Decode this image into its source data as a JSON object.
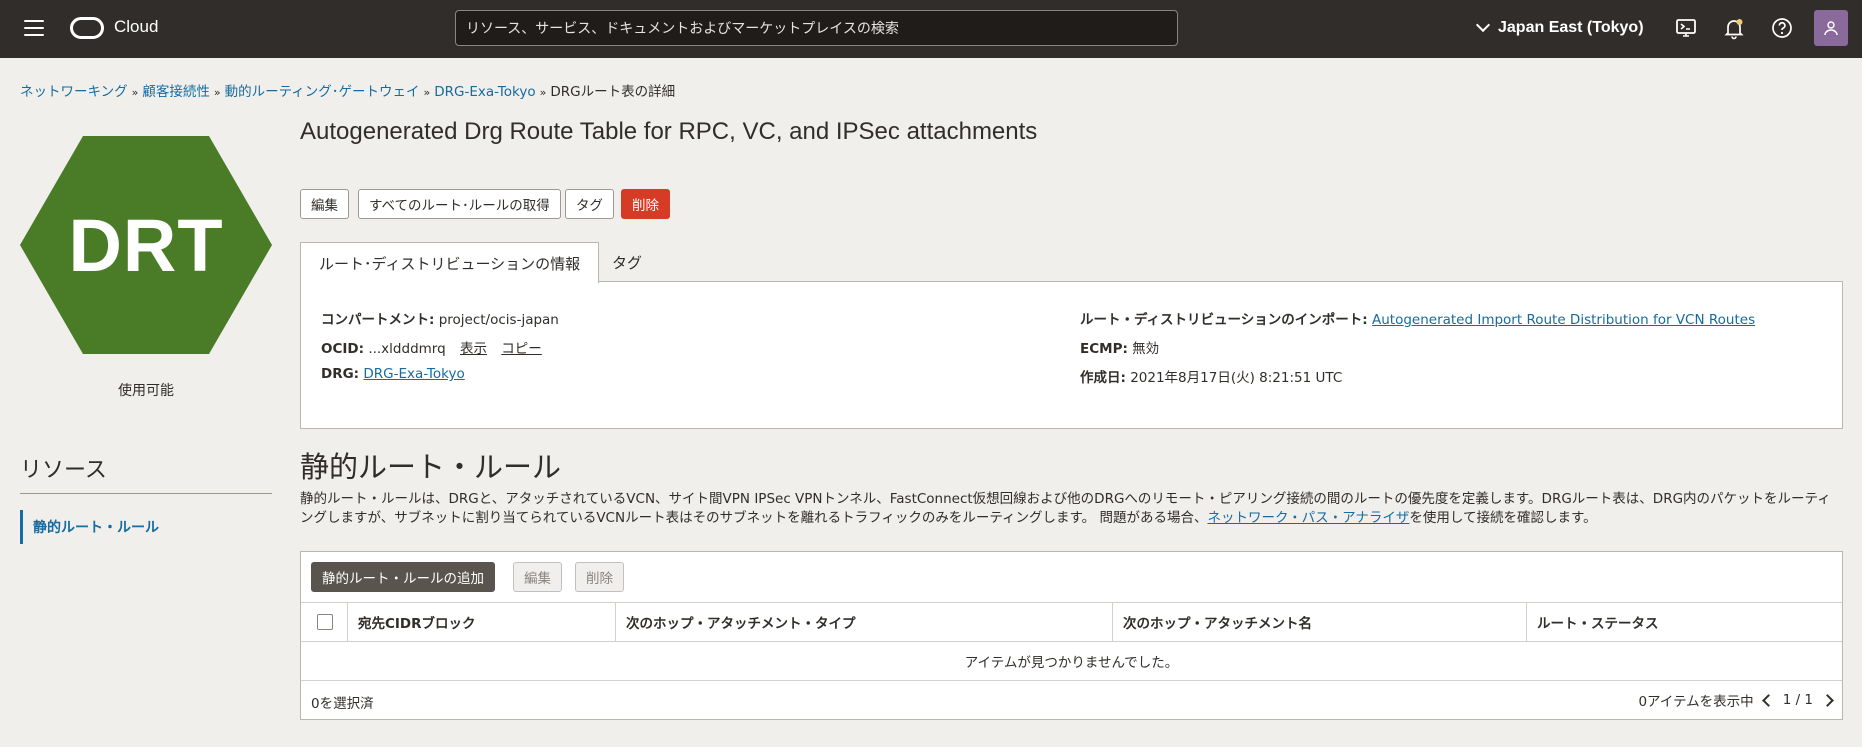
{
  "header": {
    "brand": "Cloud",
    "search_placeholder": "リソース、サービス、ドキュメントおよびマーケットプレイスの検索",
    "region": "Japan East (Tokyo)"
  },
  "breadcrumb": {
    "items": [
      "ネットワーキング",
      "顧客接続性",
      "動的ルーティング･ゲートウェイ",
      "DRG-Exa-Tokyo"
    ],
    "current": "DRGルート表の詳細",
    "separator": "»"
  },
  "resource_icon": {
    "abbr": "DRT",
    "color": "#4a7b27",
    "status": "使用可能"
  },
  "resources": {
    "title": "リソース",
    "items": [
      "静的ルート・ルール"
    ]
  },
  "page": {
    "title": "Autogenerated Drg Route Table for RPC, VC, and IPSec attachments"
  },
  "actions": {
    "edit": "編集",
    "get_all_rules": "すべてのルート･ルールの取得",
    "tags": "タグ",
    "delete": "削除"
  },
  "tabs": [
    "ルート･ディストリビューションの情報",
    "タグ"
  ],
  "info": {
    "compartment_label": "コンパートメント:",
    "compartment_value": "project/ocis-japan",
    "ocid_label": "OCID:",
    "ocid_value": "...xldddmrq",
    "ocid_show": "表示",
    "ocid_copy": "コピー",
    "drg_label": "DRG:",
    "drg_value": "DRG-Exa-Tokyo",
    "import_label": "ルート・ディストリビューションのインポート:",
    "import_value": "Autogenerated Import Route Distribution for VCN Routes",
    "ecmp_label": "ECMP:",
    "ecmp_value": "無効",
    "created_label": "作成日:",
    "created_value": "2021年8月17日(火) 8:21:51 UTC"
  },
  "rules": {
    "title": "静的ルート・ルール",
    "desc_1": "静的ルート・ルールは、DRGと、アタッチされているVCN、サイト間VPN IPSec VPNトンネル、FastConnect仮想回線および他のDRGへのリモート・ピアリング接続の間のルートの優先度を定義します。DRGルート表は、DRG内のパケットをルーティングしますが、サブネットに割り当てられているVCNルート表はそのサブネットを離れるトラフィックのみをルーティングします。 問題がある場合、",
    "desc_link": "ネットワーク・パス・アナライザ",
    "desc_2": "を使用して接続を確認します。",
    "add_button": "静的ルート・ルールの追加",
    "edit_button": "編集",
    "delete_button": "削除",
    "columns": [
      "宛先CIDRブロック",
      "次のホップ・アタッチメント・タイプ",
      "次のホップ・アタッチメント名",
      "ルート・ステータス"
    ],
    "empty_message": "アイテムが見つかりませんでした。",
    "selected_count": "0を選択済",
    "showing": "0アイテムを表示中",
    "page": "1 / 1"
  }
}
